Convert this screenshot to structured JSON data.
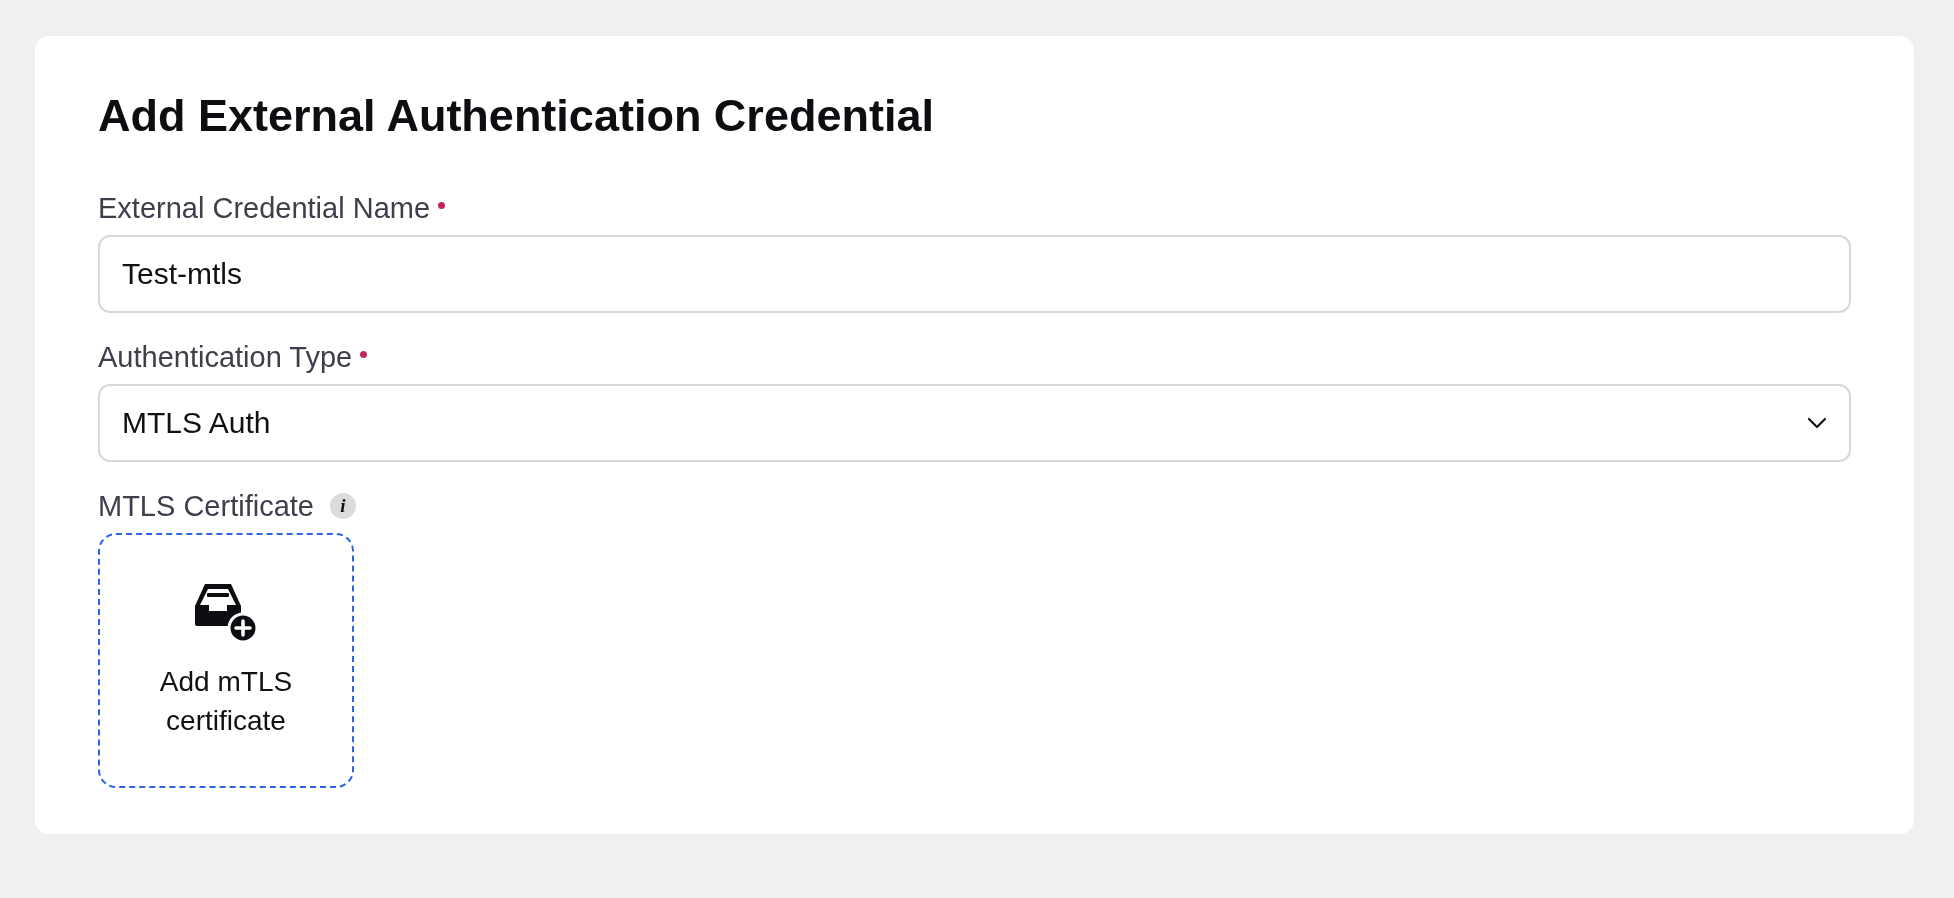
{
  "title": "Add External Authentication Credential",
  "fields": [
    {
      "kind": "text",
      "label": "External Credential Name",
      "required": true,
      "value": "Test-mtls"
    },
    {
      "kind": "select",
      "label": "Authentication Type",
      "required": true,
      "value": "MTLS Auth"
    },
    {
      "kind": "upload",
      "label": "MTLS Certificate",
      "required": false,
      "info": "i",
      "action": "Add mTLS certificate"
    }
  ]
}
